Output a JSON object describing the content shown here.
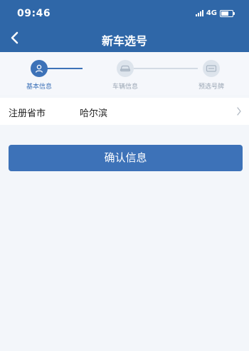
{
  "status_bar": {
    "time": "09:46",
    "network": "4G"
  },
  "header": {
    "title": "新车选号",
    "back_icon": "chevron-left-icon"
  },
  "stepper": {
    "steps": [
      {
        "label": "基本信息",
        "icon": "person-icon",
        "active": true
      },
      {
        "label": "车辆信息",
        "icon": "car-icon",
        "active": false
      },
      {
        "label": "预选号牌",
        "icon": "license-plate-icon",
        "active": false
      }
    ]
  },
  "form": {
    "registration_province": {
      "label": "注册省市",
      "value": "哈尔滨",
      "arrow_icon": "chevron-right-icon"
    }
  },
  "actions": {
    "confirm_label": "确认信息"
  },
  "colors": {
    "header_bg": "#2f67a8",
    "button_bg": "#3d72b8",
    "active_step": "#3d72b8",
    "inactive_step": "#c9d3df",
    "page_bg": "#f3f6fa"
  }
}
